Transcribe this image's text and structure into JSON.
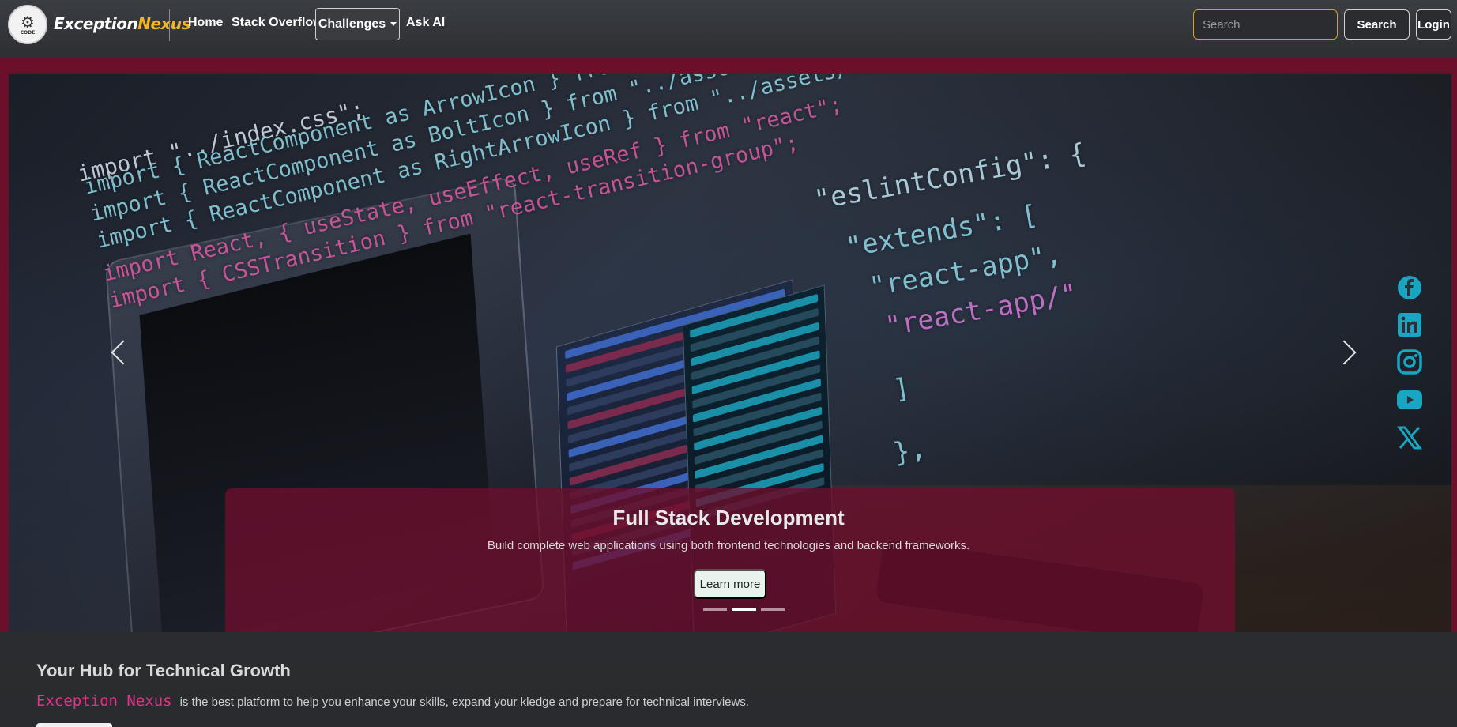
{
  "brand": {
    "name_part1": "Exception",
    "name_part2": "Nexus",
    "logo_text": "CODE",
    "logo_glyph": "⚙"
  },
  "nav": {
    "home": "Home",
    "stack_overflow": "Stack Overflow",
    "challenges": "Challenges",
    "ask_ai": "Ask AI"
  },
  "search": {
    "placeholder": "Search",
    "button_label": "Search"
  },
  "login_label": "Login",
  "hero": {
    "code_lines": [
      "import \"../index.css\";",
      "import { ReactComponent as ArrowIcon } from \"../assets/icons/arrow.svg\";",
      "import { ReactComponent as BoltIcon } from \"../assets/icons/bolt.svg\";",
      "import { ReactComponent as RightArrowIcon } from \"../assets/icons/right-arrow.svg\";",
      "import React, { useState, useEffect, useRef } from \"react\";",
      "import { CSSTransition } from \"react-transition-group\";",
      "\"eslintConfig\": {",
      "\"extends\": [",
      "\"react-app\",",
      "\"react-app/\"",
      "]",
      "},"
    ],
    "caption_title": "Full Stack Development",
    "caption_text": "Build complete web applications using both frontend technologies and backend frameworks.",
    "cta_label": "Learn more",
    "slide_count": 3,
    "active_slide": 2
  },
  "social": [
    "facebook-icon",
    "linkedin-icon",
    "instagram-icon",
    "youtube-icon",
    "x-icon"
  ],
  "colors": {
    "brand_accent": "#f2b621",
    "hero_frame": "#6b0f2b",
    "brand_pink": "#e0338a",
    "social_icon": "#1aa6c2"
  },
  "hub": {
    "title": "Your Hub for Technical Growth",
    "brand_mono": "Exception Nexus",
    "description": "is the best platform to help you enhance your skills, expand your kledge and prepare for technical interviews."
  }
}
